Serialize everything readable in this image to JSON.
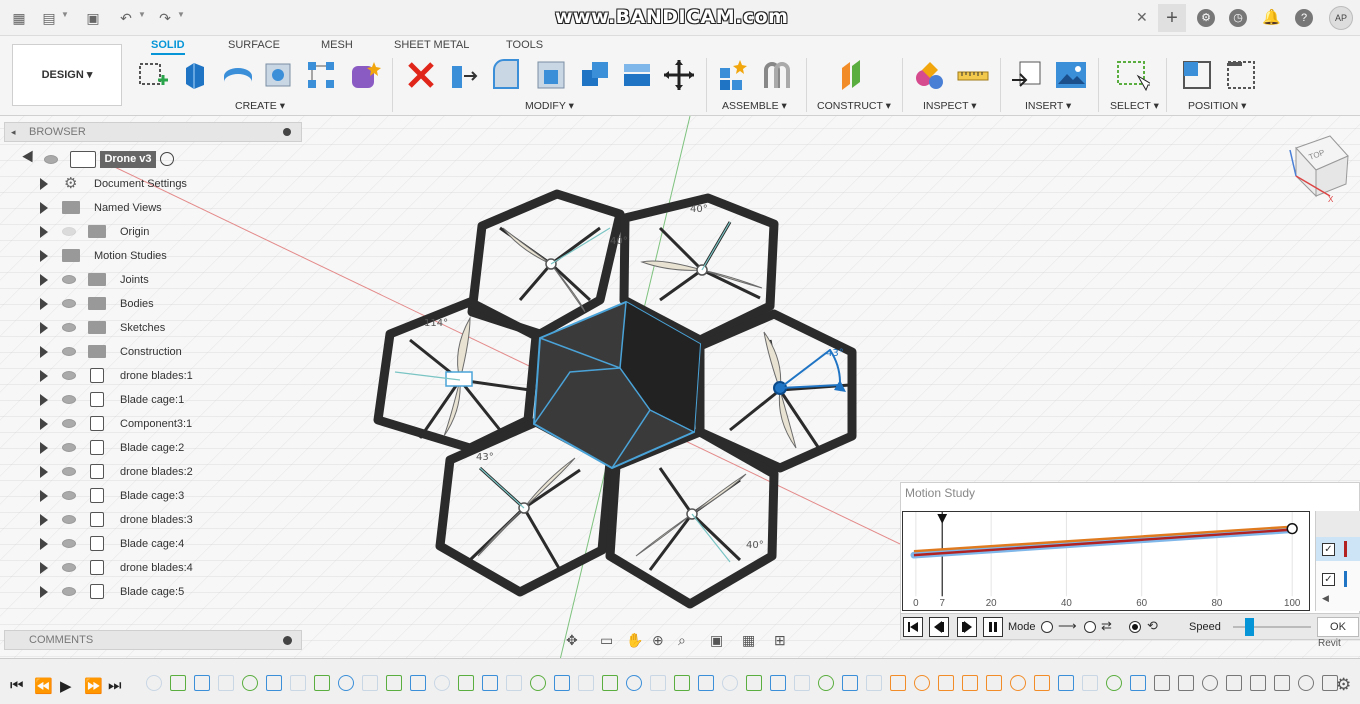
{
  "watermark": "www.BANDICAM.com",
  "user": {
    "initials": "AP"
  },
  "ribbon": {
    "workspace": "DESIGN",
    "tabs": [
      "SOLID",
      "SURFACE",
      "MESH",
      "SHEET METAL",
      "TOOLS"
    ],
    "active_tab": "SOLID",
    "groups": [
      "CREATE",
      "MODIFY",
      "ASSEMBLE",
      "CONSTRUCT",
      "INSPECT",
      "INSERT",
      "SELECT",
      "POSITION"
    ]
  },
  "browser": {
    "title": "BROWSER",
    "root": "Drone v3",
    "items": [
      {
        "label": "Document Settings",
        "kind": "settings"
      },
      {
        "label": "Named Views",
        "kind": "folder"
      },
      {
        "label": "Origin",
        "kind": "folder"
      },
      {
        "label": "Motion Studies",
        "kind": "folder"
      },
      {
        "label": "Joints",
        "kind": "folder"
      },
      {
        "label": "Bodies",
        "kind": "folder"
      },
      {
        "label": "Sketches",
        "kind": "folder"
      },
      {
        "label": "Construction",
        "kind": "folder"
      },
      {
        "label": "drone blades:1",
        "kind": "component"
      },
      {
        "label": "Blade cage:1",
        "kind": "component"
      },
      {
        "label": "Component3:1",
        "kind": "component"
      },
      {
        "label": "Blade cage:2",
        "kind": "component"
      },
      {
        "label": "drone blades:2",
        "kind": "component"
      },
      {
        "label": "Blade cage:3",
        "kind": "component"
      },
      {
        "label": "drone blades:3",
        "kind": "component"
      },
      {
        "label": "Blade cage:4",
        "kind": "component"
      },
      {
        "label": "drone blades:4",
        "kind": "component"
      },
      {
        "label": "Blade cage:5",
        "kind": "component"
      }
    ]
  },
  "comments": {
    "title": "COMMENTS"
  },
  "viewcube": {
    "face": "TOP"
  },
  "viewport": {
    "dimensions": [
      "40°",
      "114°",
      "43°",
      "43°",
      "40°",
      "40°"
    ]
  },
  "motion_study": {
    "title": "Motion Study",
    "marker": 7,
    "ticks": [
      0,
      7,
      20,
      40,
      60,
      80,
      100
    ],
    "mode_label": "Mode",
    "speed_label": "Speed",
    "speed_value": 0.2,
    "ok_label": "OK",
    "extra_label": "Revit"
  },
  "colors": {
    "accent": "#0696d7",
    "body": "#2b2b2b",
    "selection": "#4aa3d8",
    "orange": "#e07a1f",
    "red": "#b22222"
  }
}
